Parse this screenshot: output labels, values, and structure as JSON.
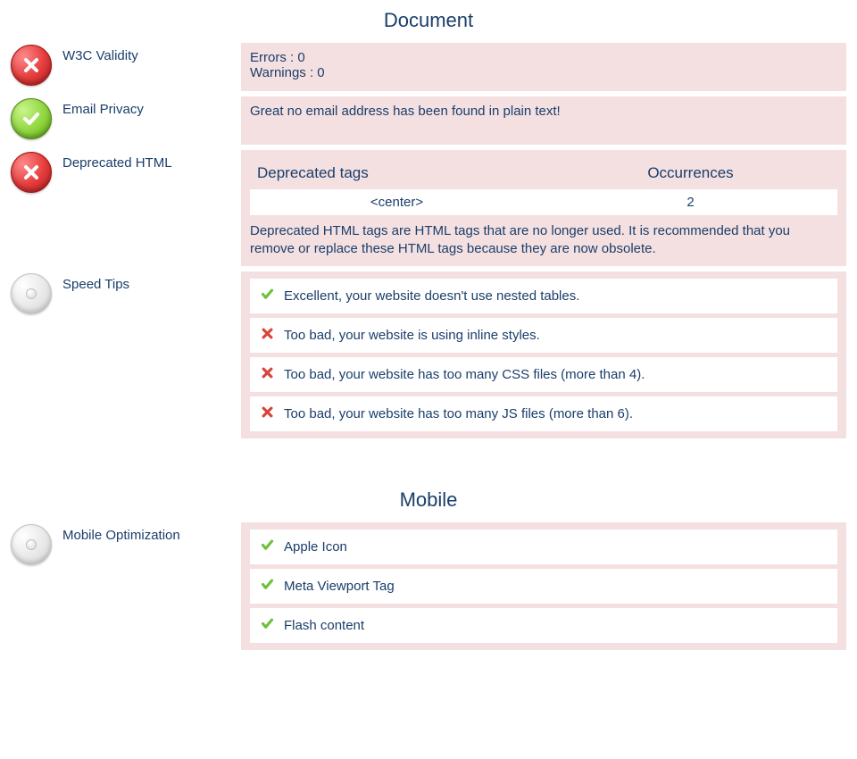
{
  "sections": {
    "document": {
      "title": "Document"
    },
    "mobile": {
      "title": "Mobile"
    }
  },
  "w3c": {
    "label": "W3C Validity",
    "errors_line": "Errors : 0",
    "warnings_line": "Warnings : 0"
  },
  "email_privacy": {
    "label": "Email Privacy",
    "text": "Great no email address has been found in plain text!"
  },
  "deprecated": {
    "label": "Deprecated HTML",
    "col_tags": "Deprecated tags",
    "col_occ": "Occurrences",
    "rows": [
      {
        "tag": "<center>",
        "count": "2"
      }
    ],
    "description": "Deprecated HTML tags are HTML tags that are no longer used. It is recommended that you remove or replace these HTML tags because they are now obsolete."
  },
  "speed_tips": {
    "label": "Speed Tips",
    "items": [
      {
        "ok": true,
        "text": "Excellent, your website doesn't use nested tables."
      },
      {
        "ok": false,
        "text": "Too bad, your website is using inline styles."
      },
      {
        "ok": false,
        "text": "Too bad, your website has too many CSS files (more than 4)."
      },
      {
        "ok": false,
        "text": "Too bad, your website has too many JS files (more than 6)."
      }
    ]
  },
  "mobile_opt": {
    "label": "Mobile Optimization",
    "items": [
      {
        "ok": true,
        "text": "Apple Icon"
      },
      {
        "ok": true,
        "text": "Meta Viewport Tag"
      },
      {
        "ok": true,
        "text": "Flash content"
      }
    ]
  }
}
